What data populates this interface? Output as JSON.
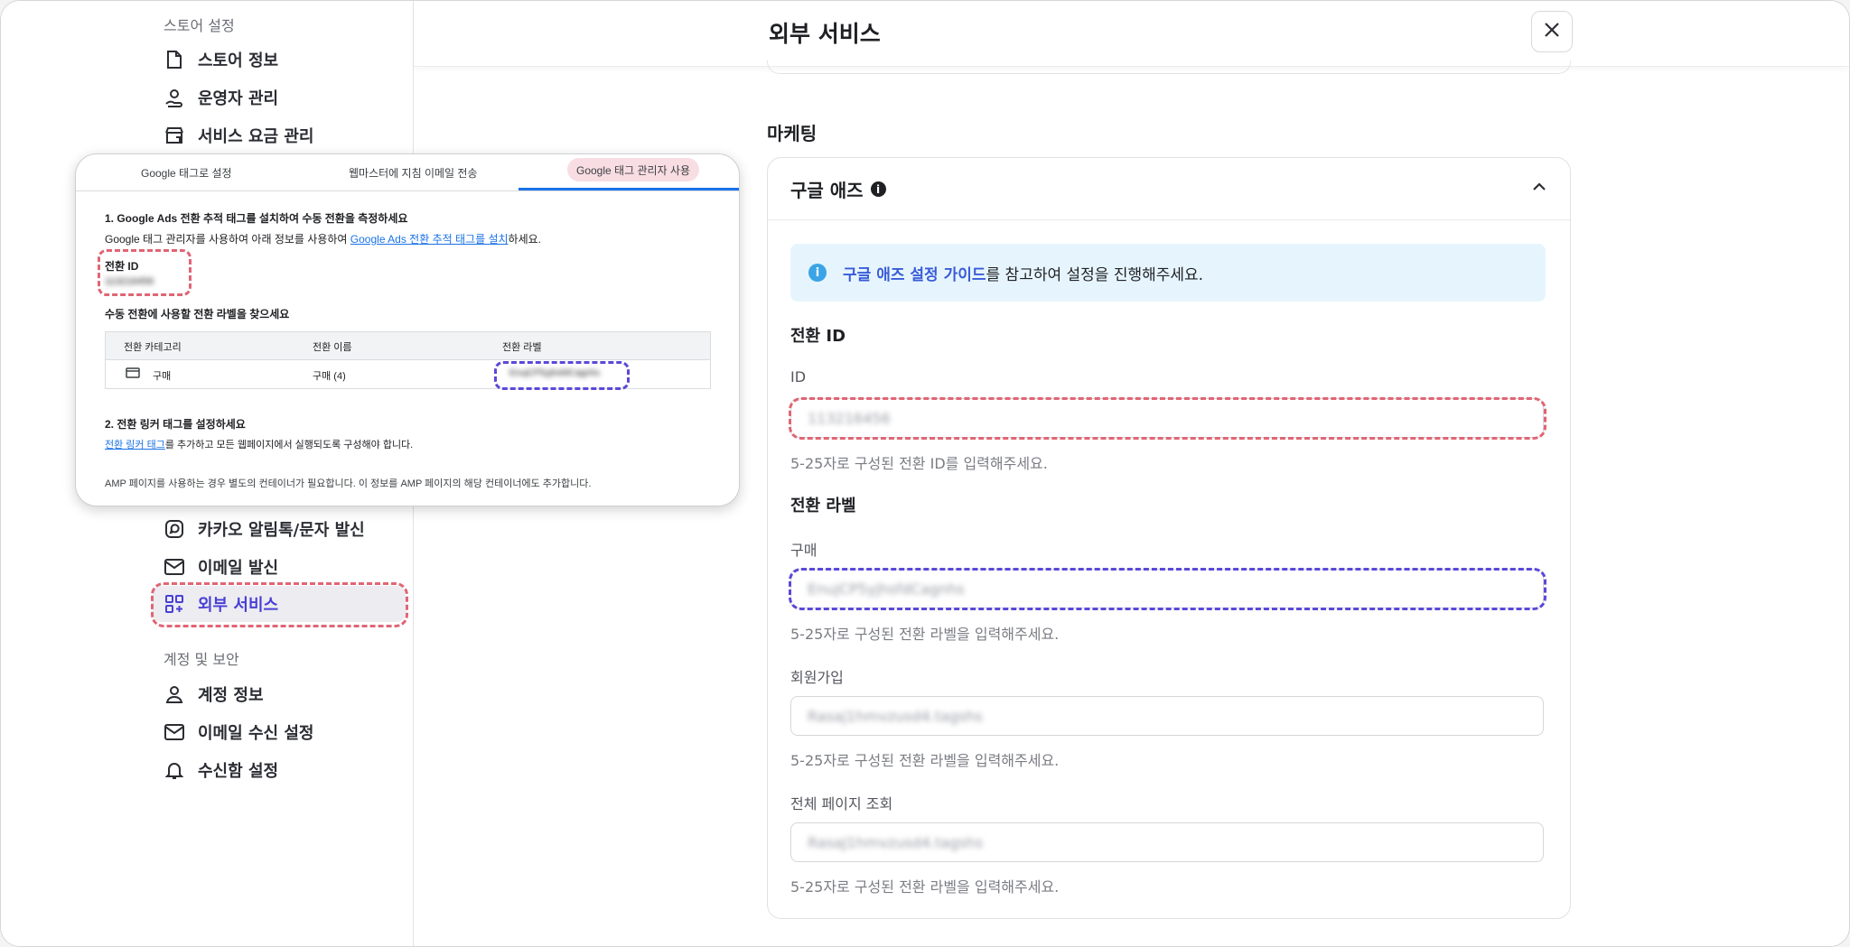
{
  "sidebar": {
    "store_settings_title": "스토어 설정",
    "store_items": [
      {
        "label": "스토어 정보",
        "icon": "file-icon"
      },
      {
        "label": "운영자 관리",
        "icon": "user-hand-icon"
      },
      {
        "label": "서비스 요금 관리",
        "icon": "store-icon"
      }
    ],
    "integration_items": [
      {
        "label": "카카오 알림톡/문자 발신",
        "icon": "chat-icon"
      },
      {
        "label": "이메일 발신",
        "icon": "mail-icon"
      },
      {
        "label": "외부 서비스",
        "icon": "apps-add-icon",
        "active": true
      }
    ],
    "account_title": "계정 및 보안",
    "account_items": [
      {
        "label": "계정 정보",
        "icon": "person-icon"
      },
      {
        "label": "이메일 수신 설정",
        "icon": "mail-icon"
      },
      {
        "label": "수신함 설정",
        "icon": "bell-icon"
      }
    ]
  },
  "header": {
    "title": "외부 서비스",
    "close_icon": "close-icon"
  },
  "main": {
    "section_title": "마케팅",
    "card": {
      "title": "구글 애즈",
      "info_glyph": "i",
      "guide_link": "구글 애즈 설정 가이드",
      "guide_rest": "를 참고하여 설정을 진행해주세요.",
      "conversion_id_heading": "전환 ID",
      "id_label": "ID",
      "id_value": "113216456",
      "id_help": "5-25자로 구성된 전환 ID를 입력해주세요.",
      "label_heading": "전환 라벨",
      "fields": [
        {
          "label": "구매",
          "value": "EnujCP5yjhsfdCagnhs",
          "help": "5-25자로 구성된 전환 라벨을 입력해주세요."
        },
        {
          "label": "회원가입",
          "value": "Rasaj1hmvzusd4.tagshs",
          "help": "5-25자로 구성된 전환 라벨을 입력해주세요."
        },
        {
          "label": "전체 페이지 조회",
          "value": "RasaJ1hmvzusd4.tagshs",
          "help": "5-25자로 구성된 전환 라벨을 입력해주세요."
        }
      ]
    }
  },
  "overlay": {
    "tabs": [
      "Google 태그로 설정",
      "웹마스터에 지침 이메일 전송",
      "Google 태그 관리자 사용"
    ],
    "step1_title": "1. Google Ads 전환 추적 태그를 설치하여 수동 전환을 측정하세요",
    "step1_desc_pre": "Google 태그 관리자를 사용하여 아래 정보를 사용하여 ",
    "step1_desc_link": "Google Ads 전환 추적 태그를 설치",
    "step1_desc_post": "하세요.",
    "conv_id_label": "전환 ID",
    "conv_id_value": "113216456",
    "find_label_title": "수동 전환에 사용할 전환 라벨을 찾으세요",
    "table_headers": [
      "전환 카테고리",
      "전환 이름",
      "전환 라벨"
    ],
    "table_row": {
      "category": "구매",
      "name": "구매 (4)",
      "label": "EnujCP5yjhsfdCagnhs"
    },
    "step2_title": "2. 전환 링커 태그를 설정하세요",
    "step2_link": "전환 링커 태그",
    "step2_rest": "를 추가하고 모든 웹페이지에서 실행되도록 구성해야 합니다.",
    "amp_note": "AMP 페이지를 사용하는 경우 별도의 컨테이너가 필요합니다. 이 정보를 AMP 페이지의 해당 컨테이너에도 추가합니다."
  },
  "colors": {
    "accent": "#4a3fd6",
    "highlight_red": "#e06574",
    "highlight_purple": "#5a49d8",
    "info_bg": "#e6f5fd"
  }
}
